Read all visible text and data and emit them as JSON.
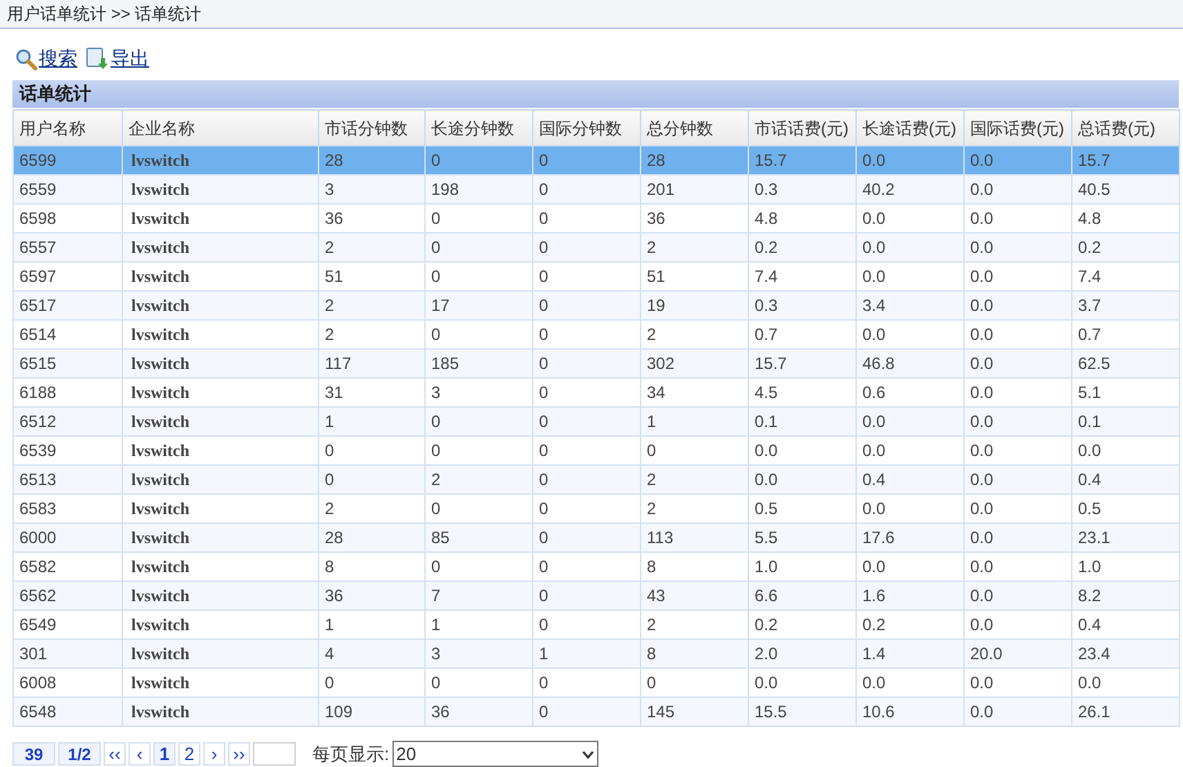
{
  "breadcrumb": "用户话单统计 >> 话单统计",
  "toolbar": [
    {
      "kind": "search",
      "label": "搜索"
    },
    {
      "kind": "export",
      "label": "导出"
    }
  ],
  "panel_title": "话单统计",
  "columns": [
    "用户名称",
    "企业名称",
    "市话分钟数",
    "长途分钟数",
    "国际分钟数",
    "总分钟数",
    "市话话费(元)",
    "长途话费(元)",
    "国际话费(元)",
    "总话费(元)"
  ],
  "rows": [
    {
      "selected": true,
      "cells": [
        "6599",
        "lvswitch",
        "28",
        "0",
        "0",
        "28",
        "15.7",
        "0.0",
        "0.0",
        "15.7"
      ]
    },
    {
      "selected": false,
      "cells": [
        "6559",
        "lvswitch",
        "3",
        "198",
        "0",
        "201",
        "0.3",
        "40.2",
        "0.0",
        "40.5"
      ]
    },
    {
      "selected": false,
      "cells": [
        "6598",
        "lvswitch",
        "36",
        "0",
        "0",
        "36",
        "4.8",
        "0.0",
        "0.0",
        "4.8"
      ]
    },
    {
      "selected": false,
      "cells": [
        "6557",
        "lvswitch",
        "2",
        "0",
        "0",
        "2",
        "0.2",
        "0.0",
        "0.0",
        "0.2"
      ]
    },
    {
      "selected": false,
      "cells": [
        "6597",
        "lvswitch",
        "51",
        "0",
        "0",
        "51",
        "7.4",
        "0.0",
        "0.0",
        "7.4"
      ]
    },
    {
      "selected": false,
      "cells": [
        "6517",
        "lvswitch",
        "2",
        "17",
        "0",
        "19",
        "0.3",
        "3.4",
        "0.0",
        "3.7"
      ]
    },
    {
      "selected": false,
      "cells": [
        "6514",
        "lvswitch",
        "2",
        "0",
        "0",
        "2",
        "0.7",
        "0.0",
        "0.0",
        "0.7"
      ]
    },
    {
      "selected": false,
      "cells": [
        "6515",
        "lvswitch",
        "117",
        "185",
        "0",
        "302",
        "15.7",
        "46.8",
        "0.0",
        "62.5"
      ]
    },
    {
      "selected": false,
      "cells": [
        "6188",
        "lvswitch",
        "31",
        "3",
        "0",
        "34",
        "4.5",
        "0.6",
        "0.0",
        "5.1"
      ]
    },
    {
      "selected": false,
      "cells": [
        "6512",
        "lvswitch",
        "1",
        "0",
        "0",
        "1",
        "0.1",
        "0.0",
        "0.0",
        "0.1"
      ]
    },
    {
      "selected": false,
      "cells": [
        "6539",
        "lvswitch",
        "0",
        "0",
        "0",
        "0",
        "0.0",
        "0.0",
        "0.0",
        "0.0"
      ]
    },
    {
      "selected": false,
      "cells": [
        "6513",
        "lvswitch",
        "0",
        "2",
        "0",
        "2",
        "0.0",
        "0.4",
        "0.0",
        "0.4"
      ]
    },
    {
      "selected": false,
      "cells": [
        "6583",
        "lvswitch",
        "2",
        "0",
        "0",
        "2",
        "0.5",
        "0.0",
        "0.0",
        "0.5"
      ]
    },
    {
      "selected": false,
      "cells": [
        "6000",
        "lvswitch",
        "28",
        "85",
        "0",
        "113",
        "5.5",
        "17.6",
        "0.0",
        "23.1"
      ]
    },
    {
      "selected": false,
      "cells": [
        "6582",
        "lvswitch",
        "8",
        "0",
        "0",
        "8",
        "1.0",
        "0.0",
        "0.0",
        "1.0"
      ]
    },
    {
      "selected": false,
      "cells": [
        "6562",
        "lvswitch",
        "36",
        "7",
        "0",
        "43",
        "6.6",
        "1.6",
        "0.0",
        "8.2"
      ]
    },
    {
      "selected": false,
      "cells": [
        "6549",
        "lvswitch",
        "1",
        "1",
        "0",
        "2",
        "0.2",
        "0.2",
        "0.0",
        "0.4"
      ]
    },
    {
      "selected": false,
      "cells": [
        "301",
        "lvswitch",
        "4",
        "3",
        "1",
        "8",
        "2.0",
        "1.4",
        "20.0",
        "23.4"
      ]
    },
    {
      "selected": false,
      "cells": [
        "6008",
        "lvswitch",
        "0",
        "0",
        "0",
        "0",
        "0.0",
        "0.0",
        "0.0",
        "0.0"
      ]
    },
    {
      "selected": false,
      "cells": [
        "6548",
        "lvswitch",
        "109",
        "36",
        "0",
        "145",
        "15.5",
        "10.6",
        "0.0",
        "26.1"
      ]
    }
  ],
  "pager": {
    "total": "39",
    "page": "1/2",
    "buttons": [
      {
        "label": "‹‹",
        "current": false
      },
      {
        "label": "‹",
        "current": false
      },
      {
        "label": "1",
        "current": true
      },
      {
        "label": "2",
        "current": false
      },
      {
        "label": "›",
        "current": false
      },
      {
        "label": "››",
        "current": false
      }
    ],
    "page_size_label": "每页显示:",
    "page_size": "20"
  }
}
